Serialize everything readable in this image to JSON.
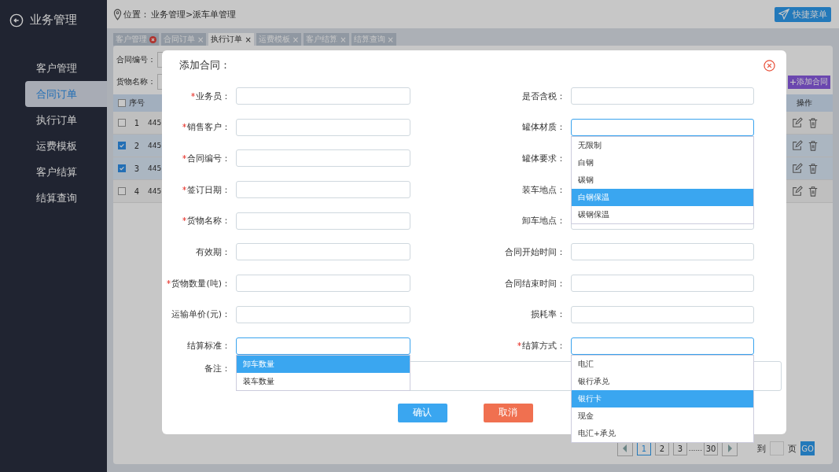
{
  "sidebar": {
    "title": "业务管理",
    "items": [
      {
        "label": "客户管理",
        "selected": false
      },
      {
        "label": "合同订单",
        "selected": true
      },
      {
        "label": "执行订单",
        "selected": false
      },
      {
        "label": "运费模板",
        "selected": false
      },
      {
        "label": "客户结算",
        "selected": false
      },
      {
        "label": "结算查询",
        "selected": false
      }
    ]
  },
  "topbar": {
    "location_label": "位置：",
    "breadcrumb": "业务管理>派车单管理",
    "quick_menu": "快捷菜单"
  },
  "tabs": [
    {
      "label": "客户管理",
      "selected": false,
      "kind": "error"
    },
    {
      "label": "合同订单",
      "selected": false,
      "kind": "normal",
      "close": "×"
    },
    {
      "label": "执行订单",
      "selected": true,
      "kind": "normal",
      "close": "×"
    },
    {
      "label": "运费模板",
      "selected": false,
      "kind": "normal",
      "close": "×"
    },
    {
      "label": "客户结算",
      "selected": false,
      "kind": "normal",
      "close": "×"
    },
    {
      "label": "结算查询",
      "selected": false,
      "kind": "normal",
      "close": "×"
    }
  ],
  "filters": [
    {
      "label": "合同编号："
    },
    {
      "label": "货物名称："
    }
  ],
  "add_button": "添加合同",
  "table": {
    "all_checked": false,
    "columns": [
      "序号",
      "操作"
    ],
    "rows": [
      {
        "checked": false,
        "index": "1",
        "column_2": "445"
      },
      {
        "checked": true,
        "index": "2",
        "column_2": "445"
      },
      {
        "checked": true,
        "index": "3",
        "column_2": "445"
      },
      {
        "checked": false,
        "index": "4",
        "column_2": "445"
      }
    ]
  },
  "pagination": {
    "pages": [
      {
        "label": "1",
        "selected": true
      },
      {
        "label": "2",
        "selected": false
      },
      {
        "label": "3",
        "selected": false
      },
      {
        "label": "......",
        "kind": "gap"
      },
      {
        "label": "30",
        "selected": false
      }
    ],
    "goto_label": "到",
    "page_label": "页",
    "go_button": "GO"
  },
  "dialog": {
    "title": "添加合同：",
    "left_fields": [
      {
        "label": "业务员：",
        "required": true,
        "focused": false
      },
      {
        "label": "销售客户：",
        "required": true,
        "focused": false
      },
      {
        "label": "合同编号：",
        "required": true,
        "focused": false
      },
      {
        "label": "签订日期：",
        "required": true,
        "focused": false
      },
      {
        "label": "货物名称：",
        "required": true,
        "focused": false
      },
      {
        "label": "有效期：",
        "required": false,
        "focused": false
      },
      {
        "label": "货物数量(吨)：",
        "required": true,
        "focused": false
      },
      {
        "label": "运输单价(元)：",
        "required": false,
        "focused": false
      },
      {
        "label": "结算标准：",
        "required": false,
        "focused": true,
        "options": [
          {
            "label": "卸车数量",
            "selected": true
          },
          {
            "label": "装车数量",
            "selected": false
          }
        ]
      }
    ],
    "right_fields": [
      {
        "label": "是否含税：",
        "required": false,
        "focused": false
      },
      {
        "label": "罐体材质：",
        "required": false,
        "focused": true,
        "options": [
          {
            "label": "无限制",
            "selected": false
          },
          {
            "label": "白钢",
            "selected": false
          },
          {
            "label": "碳钢",
            "selected": false
          },
          {
            "label": "白钢保温",
            "selected": true
          },
          {
            "label": "碳钢保温",
            "selected": false
          }
        ]
      },
      {
        "label": "罐体要求：",
        "required": false
      },
      {
        "label": "装车地点：",
        "required": false
      },
      {
        "label": "卸车地点：",
        "required": false,
        "focused": false
      },
      {
        "label": "合同开始时间：",
        "required": false,
        "focused": false
      },
      {
        "label": "合同结束时间：",
        "required": false,
        "focused": false
      },
      {
        "label": "损耗率：",
        "required": false,
        "focused": false
      },
      {
        "label": "结算方式：",
        "required": true,
        "focused": true,
        "options": [
          {
            "label": "电汇",
            "selected": false
          },
          {
            "label": "银行承兑",
            "selected": false
          },
          {
            "label": "银行卡",
            "selected": true
          },
          {
            "label": "现金",
            "selected": false
          },
          {
            "label": "电汇+承兑",
            "selected": false
          }
        ]
      }
    ],
    "remark_label": "备注：",
    "buttons": [
      {
        "label": "确认",
        "kind": "primary"
      },
      {
        "label": "取消",
        "kind": "cancel"
      }
    ]
  }
}
